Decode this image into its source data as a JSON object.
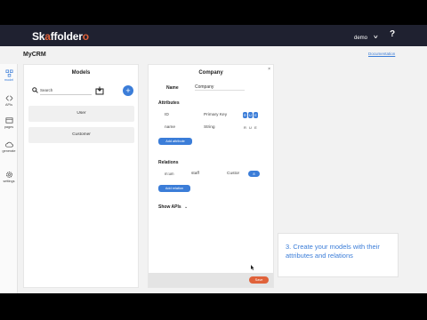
{
  "topbar": {
    "logo": {
      "part1": "Sk",
      "ring": "a",
      "part2": "ffolder",
      "tail": "o"
    },
    "user": "demo",
    "help": "?"
  },
  "app": {
    "name": "MyCRM",
    "doc_link": "Documentation"
  },
  "sidebar": {
    "items": [
      {
        "label": "model",
        "icon": "model-icon",
        "active": true
      },
      {
        "label": "APIs",
        "icon": "api-icon"
      },
      {
        "label": "pages",
        "icon": "pages-icon"
      },
      {
        "label": "generate",
        "icon": "cloud-icon"
      },
      {
        "label": "settings",
        "icon": "gear-icon"
      }
    ]
  },
  "models_panel": {
    "title": "Models",
    "search_placeholder": "Search",
    "add_label": "+",
    "items": [
      "User",
      "Customer"
    ]
  },
  "company_panel": {
    "title": "Company",
    "close": "×",
    "name_label": "Name",
    "name_value": "Company",
    "attributes_label": "Attributes",
    "attributes": [
      {
        "name": "ID",
        "type": "Primary Key",
        "flags": [
          "R",
          "U",
          "E"
        ]
      },
      {
        "name": "name",
        "type": "String",
        "flags": [
          "R",
          "U",
          "E"
        ]
      }
    ],
    "add_attribute": "Add attribute",
    "relations_label": "Relations",
    "relations": [
      {
        "kind": "m:um",
        "name": "staff",
        "target": "Custor",
        "tag": "8"
      }
    ],
    "add_relation": "Add relation",
    "show_apis": "Show APIs",
    "save": "Save"
  },
  "callout": {
    "text": "3. Create your models with their attributes and relations"
  },
  "colors": {
    "accent": "#3b7dd8",
    "brand": "#e0623a",
    "topbar": "#1f2130"
  }
}
